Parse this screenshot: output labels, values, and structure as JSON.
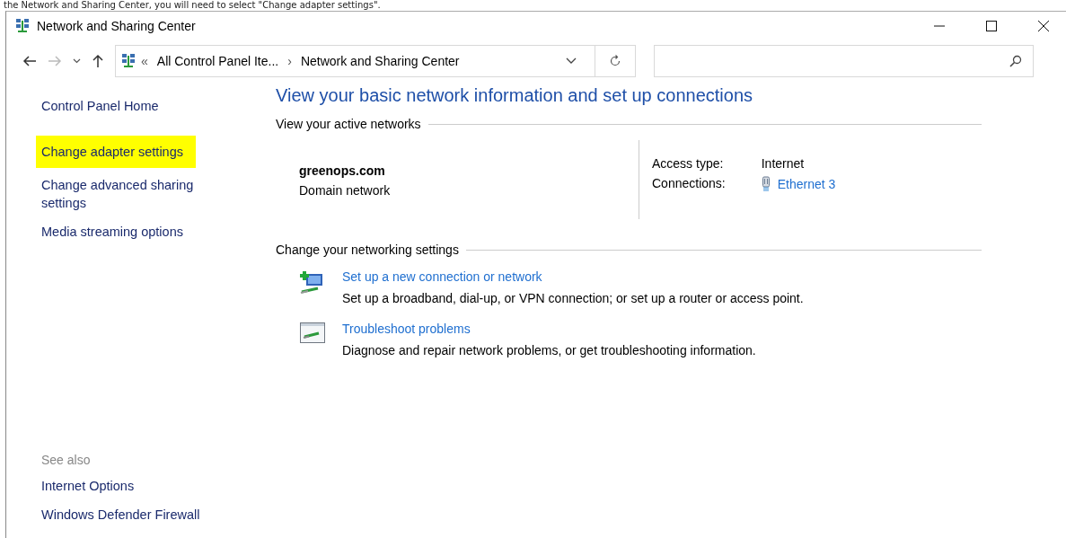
{
  "caption": "the Network and Sharing Center, you will need to select \"Change adapter settings\".",
  "window": {
    "title": "Network and Sharing Center"
  },
  "address_bar": {
    "crumbs": [
      "«",
      "All Control Panel Ite...",
      "›",
      "Network and Sharing Center"
    ]
  },
  "sidebar": {
    "items": [
      {
        "label": "Control Panel Home",
        "highlighted": false
      },
      {
        "label": "Change adapter settings",
        "highlighted": true
      },
      {
        "label": "Change advanced sharing settings",
        "highlighted": false
      },
      {
        "label": "Media streaming options",
        "highlighted": false
      }
    ],
    "see_also": {
      "heading": "See also",
      "items": [
        "Internet Options",
        "Windows Defender Firewall"
      ]
    }
  },
  "main": {
    "heading": "View your basic network information and set up connections",
    "active_networks": {
      "heading": "View your active networks",
      "name": "greenops.com",
      "category": "Domain network",
      "details": [
        {
          "label": "Access type:",
          "value": "Internet",
          "kind": "text"
        },
        {
          "label": "Connections:",
          "value": "Ethernet 3",
          "kind": "link"
        }
      ]
    },
    "settings": {
      "heading": "Change your networking settings",
      "tasks": [
        {
          "kind": "new-connection",
          "title": "Set up a new connection or network",
          "description": "Set up a broadband, dial-up, or VPN connection; or set up a router or access point."
        },
        {
          "kind": "troubleshoot",
          "title": "Troubleshoot problems",
          "description": "Diagnose and repair network problems, or get troubleshooting information."
        }
      ]
    }
  }
}
